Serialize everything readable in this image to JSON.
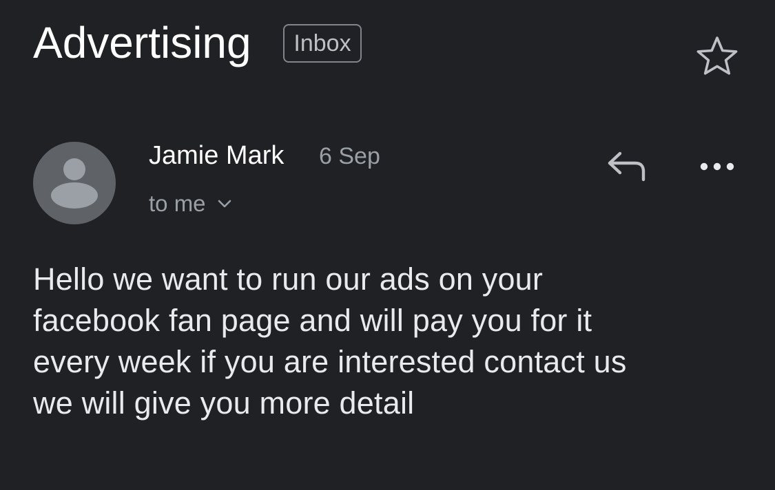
{
  "email": {
    "subject": "Advertising",
    "label": "Inbox",
    "sender": {
      "name": "Jamie Mark",
      "date": "6 Sep",
      "recipients": "to me"
    },
    "body_lines": [
      "Hello we want to run our ads on your",
      "facebook fan page and will pay you for it",
      "every week if you are interested contact us",
      "we will give you more detail"
    ]
  },
  "icons": {
    "star": "star-outline-icon",
    "avatar": "default-avatar-icon",
    "reply": "reply-icon",
    "more": "more-horizontal-icon",
    "chevron": "chevron-down-icon"
  },
  "colors": {
    "background": "#202124",
    "primary_text": "#ffffff",
    "body_text": "#e8eaed",
    "secondary_text": "#9aa0a6",
    "avatar_bg": "#5f6368",
    "avatar_fg": "#9aa0a6",
    "chip_border": "#80868b"
  }
}
